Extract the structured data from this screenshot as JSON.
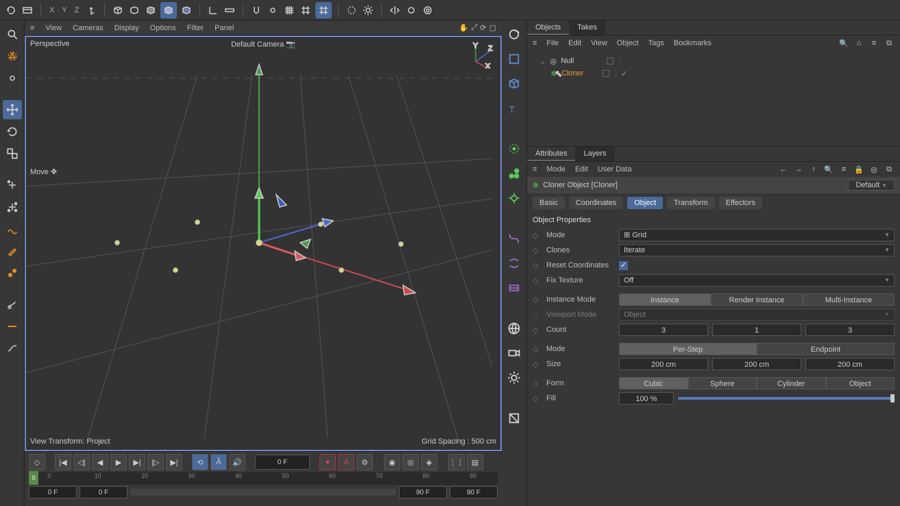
{
  "topbar": {
    "axes": [
      "X",
      "Y",
      "Z"
    ]
  },
  "view_menu": {
    "items": [
      "View",
      "Cameras",
      "Display",
      "Options",
      "Filter",
      "Panel"
    ]
  },
  "viewport": {
    "name": "Perspective",
    "camera": "Default Camera",
    "tool": "Move",
    "transform": "View Transform: Project",
    "grid": "Grid Spacing : 500 cm",
    "mini_axes": {
      "y": "Y",
      "z": "Z",
      "x": "X"
    }
  },
  "timeline": {
    "current": "0 F",
    "ticks": [
      "0",
      "10",
      "20",
      "30",
      "40",
      "50",
      "60",
      "70",
      "80",
      "90"
    ],
    "start": "0 F",
    "start2": "0 F",
    "end": "90 F",
    "end2": "90 F",
    "marker": "0"
  },
  "objects_panel": {
    "tabs": [
      "Objects",
      "Takes"
    ],
    "menu": [
      "File",
      "Edit",
      "View",
      "Object",
      "Tags",
      "Bookmarks"
    ],
    "tree": [
      {
        "name": "Null",
        "selected": false
      },
      {
        "name": "Cloner",
        "selected": true
      }
    ]
  },
  "attributes_panel": {
    "tabs": [
      "Attributes",
      "Layers"
    ],
    "menu": [
      "Mode",
      "Edit",
      "User Data"
    ],
    "title": "Cloner Object [Cloner]",
    "preset": "Default",
    "subtabs": [
      "Basic",
      "Coordinates",
      "Object",
      "Transform",
      "Effectors"
    ],
    "section": "Object Properties",
    "props": {
      "mode_label": "Mode",
      "mode_value": "Grid",
      "clones_label": "Clones",
      "clones_value": "Iterate",
      "reset_label": "Reset Coordinates",
      "fix_label": "Fix Texture",
      "fix_value": "Off",
      "instance_label": "Instance Mode",
      "instance_opts": [
        "Instance",
        "Render Instance",
        "Multi-Instance"
      ],
      "vpmode_label": "Viewport Mode",
      "vpmode_value": "Object",
      "count_label": "Count",
      "count": [
        "3",
        "1",
        "3"
      ],
      "step_label": "Mode",
      "step_opts": [
        "Per-Step",
        "Endpoint"
      ],
      "size_label": "Size",
      "size": [
        "200 cm",
        "200 cm",
        "200 cm"
      ],
      "form_label": "Form",
      "form_opts": [
        "Cubic",
        "Sphere",
        "Cylinder",
        "Object"
      ],
      "fill_label": "Fill",
      "fill_value": "100 %"
    }
  }
}
